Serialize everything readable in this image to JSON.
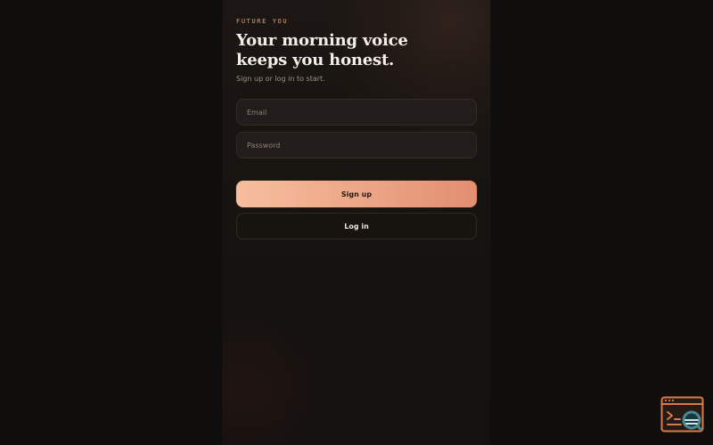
{
  "auth": {
    "eyebrow": "FUTURE YOU",
    "headline": "Your morning voice keeps you honest.",
    "subtitle": "Sign up or log in to start.",
    "fields": {
      "email_placeholder": "Email",
      "password_placeholder": "Password"
    },
    "buttons": {
      "signup": "Sign up",
      "login": "Log in"
    }
  },
  "colors": {
    "background": "#0f0e0d",
    "panel": "#1c1714",
    "accent": "#eca487",
    "text": "#f5ede7",
    "tool_orange": "#d8794f",
    "tool_teal": "#4d8790"
  },
  "icons": {
    "floating_tool": "browser-terminal-search-icon"
  }
}
